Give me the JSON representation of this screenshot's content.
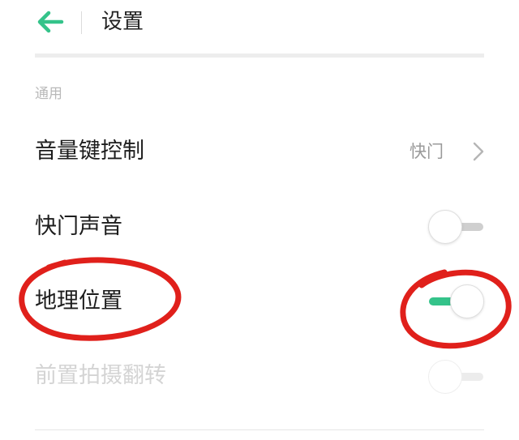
{
  "header": {
    "title": "设置",
    "back_icon": "arrow-left-icon",
    "accent_color": "#34c38a"
  },
  "section": {
    "label": "通用"
  },
  "rows": [
    {
      "label": "音量键控制",
      "value": "快门",
      "control": "chevron-right-icon"
    },
    {
      "label": "快门声音",
      "control": "toggle",
      "state": "off"
    },
    {
      "label": "地理位置",
      "control": "toggle",
      "state": "on"
    },
    {
      "label": "前置拍摄翻转",
      "control": "toggle",
      "state": "off",
      "disabled": true
    }
  ],
  "annotations": {
    "color": "#e0201b",
    "marks": [
      "circle-around-地理位置",
      "circle-around-地理位置-toggle"
    ]
  }
}
